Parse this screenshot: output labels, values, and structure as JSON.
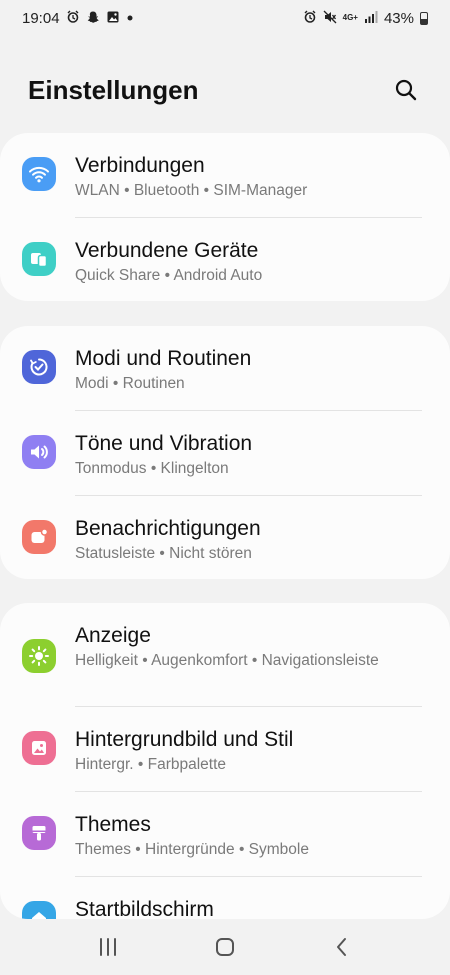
{
  "status_bar": {
    "time": "19:04",
    "battery": "43%",
    "network": "4G+"
  },
  "header": {
    "title": "Einstellungen"
  },
  "sections": [
    {
      "items": [
        {
          "title": "Verbindungen",
          "subtitle": "WLAN  •  Bluetooth  •  SIM-Manager",
          "icon": "wifi-icon",
          "color": "#4a9df5"
        },
        {
          "title": "Verbundene Geräte",
          "subtitle": "Quick Share  •  Android Auto",
          "icon": "connected-devices-icon",
          "color": "#3fcfc6"
        }
      ]
    },
    {
      "items": [
        {
          "title": "Modi und Routinen",
          "subtitle": "Modi  •  Routinen",
          "icon": "modes-icon",
          "color": "#4f66d9"
        },
        {
          "title": "Töne und Vibration",
          "subtitle": "Tonmodus  •  Klingelton",
          "icon": "speaker-icon",
          "color": "#8f7ff2"
        },
        {
          "title": "Benachrichtigungen",
          "subtitle": "Statusleiste  •  Nicht stören",
          "icon": "notification-icon",
          "color": "#f2786a"
        }
      ]
    },
    {
      "items": [
        {
          "title": "Anzeige",
          "subtitle": "Helligkeit  •  Augenkomfort  •  Navigationsleiste",
          "icon": "brightness-icon",
          "color": "#8ccf2f"
        },
        {
          "title": "Hintergrundbild und Stil",
          "subtitle": "Hintergr.  •  Farbpalette",
          "icon": "wallpaper-icon",
          "color": "#ee6f93"
        },
        {
          "title": "Themes",
          "subtitle": "Themes  •  Hintergründe  •  Symbole",
          "icon": "themes-icon",
          "color": "#b76ad6"
        },
        {
          "title": "Startbildschirm",
          "subtitle": "",
          "icon": "home-icon",
          "color": "#35a6e6"
        }
      ]
    }
  ]
}
